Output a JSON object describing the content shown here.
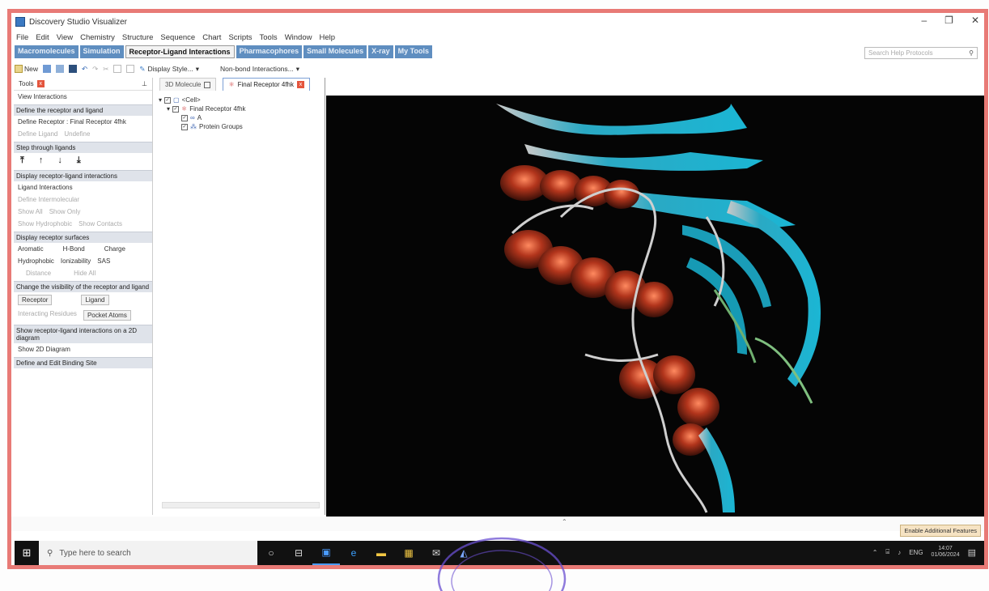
{
  "window": {
    "title": "Discovery Studio Visualizer",
    "controls": [
      "–",
      "❐",
      "✕"
    ]
  },
  "menu": [
    "File",
    "Edit",
    "View",
    "Chemistry",
    "Structure",
    "Sequence",
    "Chart",
    "Scripts",
    "Tools",
    "Window",
    "Help"
  ],
  "ribbon_tabs": [
    {
      "label": "Macromolecules",
      "active": false
    },
    {
      "label": "Simulation",
      "active": false
    },
    {
      "label": "Receptor-Ligand Interactions",
      "active": true
    },
    {
      "label": "Pharmacophores",
      "active": false
    },
    {
      "label": "Small Molecules",
      "active": false
    },
    {
      "label": "X-ray",
      "active": false
    },
    {
      "label": "My Tools",
      "active": false
    }
  ],
  "search": {
    "placeholder": "Search Help Protocols",
    "icon": "search-icon"
  },
  "toolbar": {
    "new_label": "New",
    "display_style": "Display Style...",
    "nonbond": "Non-bond Interactions..."
  },
  "tools_panel": {
    "title": "Tools",
    "view_interactions": "View Interactions",
    "define_header": "Define the receptor and ligand",
    "define_receptor": "Define Receptor : Final Receptor 4fhk",
    "define_ligand_items": [
      "Define Ligand",
      "Undefine"
    ],
    "step_header": "Step through ligands",
    "display_header": "Display receptor-ligand interactions",
    "ligand_interactions": "Ligand Interactions",
    "muted_items": [
      "Define Intermolecular",
      "Show All",
      "Show Only",
      "Show Hydrophobic",
      "Show Contacts"
    ],
    "surfaces_header": "Display receptor surfaces",
    "surface_opts": [
      "Aromatic",
      "H-Bond",
      "Charge",
      "Hydrophobic",
      "Ionizability",
      "SAS"
    ],
    "surface_muted": [
      "Distance",
      "Hide All"
    ],
    "visibility_header": "Change the visibility of the receptor and ligand",
    "receptor_btn": "Receptor",
    "ligand_btn": "Ligand",
    "interacting_hidden": "Interacting Residues",
    "pocket_atoms": "Pocket Atoms",
    "show2d_header": "Show receptor-ligand interactions on a 2D diagram",
    "show2d": "Show 2D Diagram",
    "define_site": "Define and Edit Binding Site"
  },
  "doc_tabs": [
    {
      "label": "3D Molecule",
      "active": false
    },
    {
      "label": "Final Receptor 4fhk",
      "active": true
    }
  ],
  "tree": [
    {
      "label": "<Cell>",
      "level": 0
    },
    {
      "label": "Final Receptor 4fhk",
      "level": 1
    },
    {
      "label": "A",
      "level": 2
    },
    {
      "label": "Protein Groups",
      "level": 2
    }
  ],
  "status": {
    "enable_features": "Enable Additional Features"
  },
  "taskbar": {
    "search_placeholder": "Type here to search",
    "apps": [
      "○",
      "⊟",
      "▣",
      "e",
      "▬",
      "▦",
      "✉",
      "◭"
    ],
    "lang": "ENG",
    "time": "14:07",
    "date": "01/06/2024"
  }
}
